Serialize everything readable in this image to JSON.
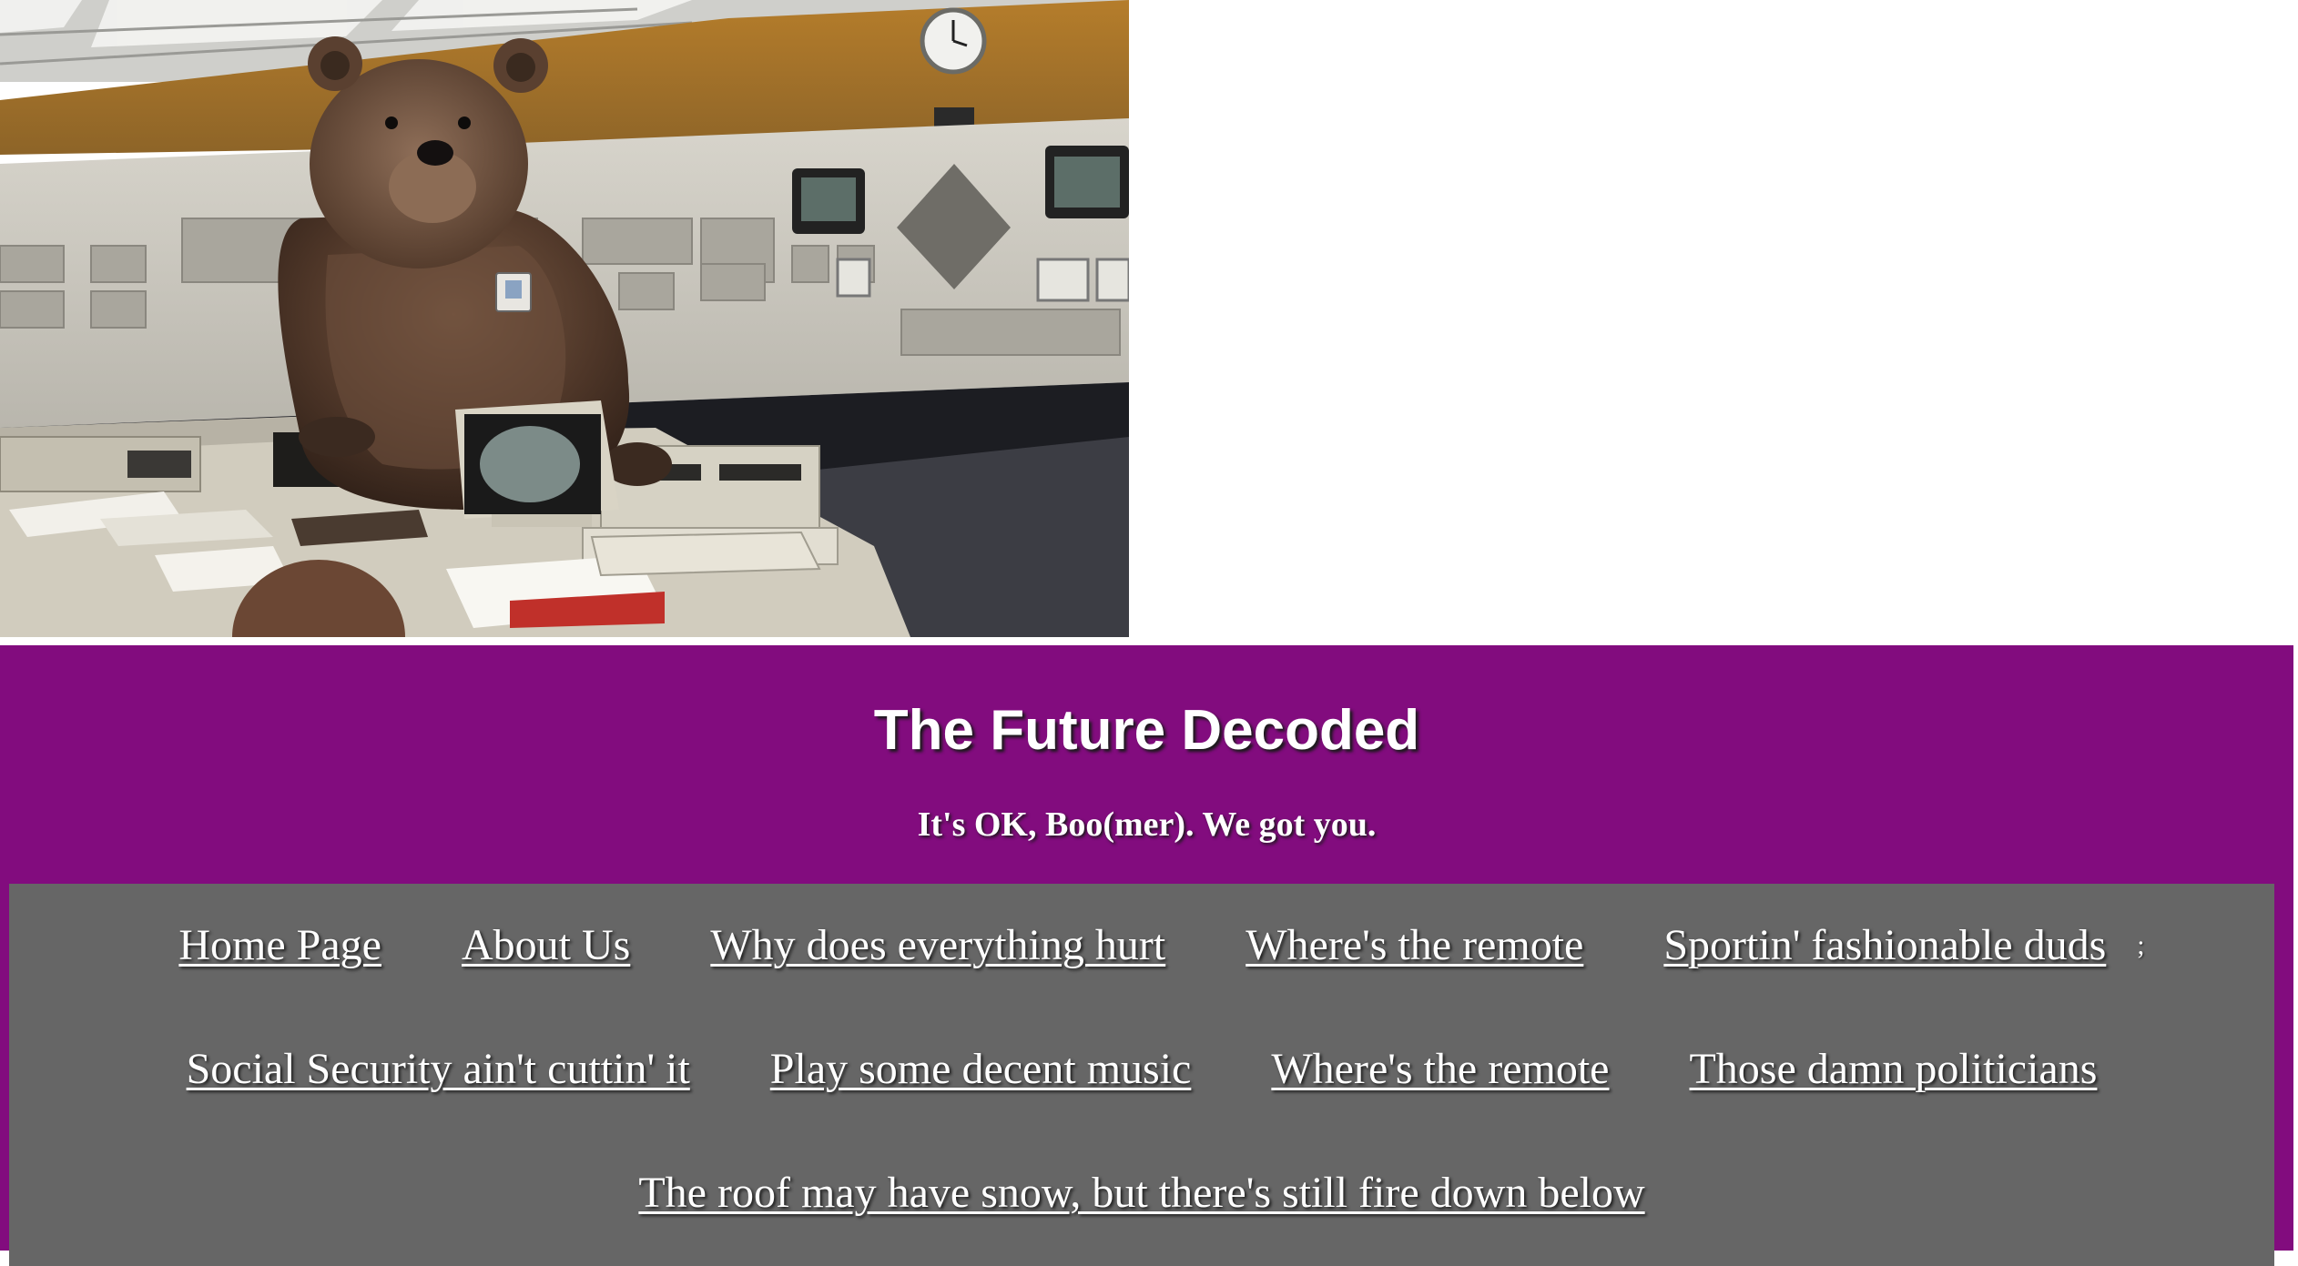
{
  "hero": {
    "alt": "Bear standing at a control room console"
  },
  "header": {
    "title": "The Future Decoded",
    "tagline": "It's OK, Boo(mer). We got you."
  },
  "nav": {
    "row1": [
      "Home Page",
      "About Us",
      "Why does everything hurt",
      "Where's the remote",
      "Sportin' fashionable duds"
    ],
    "row1_trailing": ";",
    "row2": [
      "Social Security ain't cuttin' it",
      "Play some decent music",
      "Where's the remote",
      "Those damn politicians"
    ],
    "row3": [
      "The roof may have snow, but there's still fire down below"
    ]
  },
  "colors": {
    "band": "#820c7e",
    "nav_panel": "#666666",
    "text": "#ffffff"
  }
}
